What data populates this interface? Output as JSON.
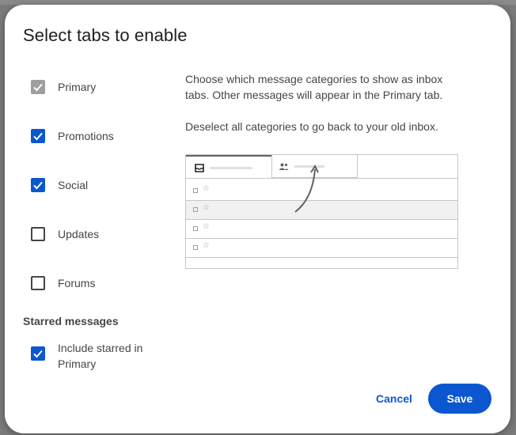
{
  "dialog": {
    "title": "Select tabs to enable",
    "options": [
      {
        "label": "Primary",
        "state": "disabled-checked"
      },
      {
        "label": "Promotions",
        "state": "checked"
      },
      {
        "label": "Social",
        "state": "checked"
      },
      {
        "label": "Updates",
        "state": "unchecked"
      },
      {
        "label": "Forums",
        "state": "unchecked"
      }
    ],
    "starred_heading": "Starred messages",
    "starred_option": {
      "label": "Include starred in Primary",
      "state": "checked"
    },
    "description_1": "Choose which message categories to show as inbox tabs. Other messages will appear in the Primary tab.",
    "description_2": "Deselect all categories to go back to your old inbox.",
    "cancel_label": "Cancel",
    "save_label": "Save"
  },
  "illustration": {
    "tab_icons": [
      "inbox-icon",
      "people-icon"
    ],
    "row_count": 4,
    "highlighted_row": 1
  },
  "colors": {
    "accent": "#0b57d0",
    "disabled_checkbox": "#9e9e9e",
    "text": "#444746",
    "title": "#1f1f1f"
  }
}
